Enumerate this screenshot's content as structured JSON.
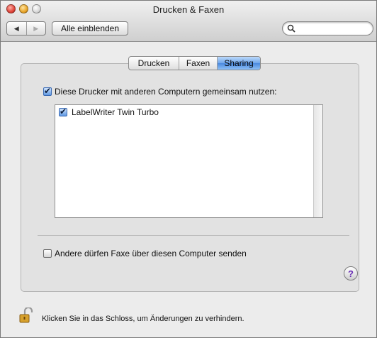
{
  "window": {
    "title": "Drucken & Faxen"
  },
  "toolbar": {
    "show_all_label": "Alle einblenden",
    "search_placeholder": ""
  },
  "tabs": [
    {
      "label": "Drucken",
      "active": false
    },
    {
      "label": "Faxen",
      "active": false
    },
    {
      "label": "Sharing",
      "active": true
    }
  ],
  "sharing": {
    "share_printers_label": "Diese Drucker mit anderen Computern gemeinsam nutzen:",
    "share_printers_checked": true,
    "printers": [
      {
        "name": "LabelWriter Twin Turbo",
        "checked": true
      }
    ],
    "allow_fax_label": "Andere dürfen Faxe über diesen Computer senden",
    "allow_fax_checked": false
  },
  "help": {
    "label": "?"
  },
  "lock": {
    "text": "Klicken Sie in das Schloss, um Änderungen zu verhindern."
  },
  "colors": {
    "accent": "#4a89de",
    "help_glyph": "#6a2fb5"
  },
  "icons": [
    "back-arrow-icon",
    "forward-arrow-icon",
    "search-icon",
    "lock-icon",
    "help-icon"
  ]
}
